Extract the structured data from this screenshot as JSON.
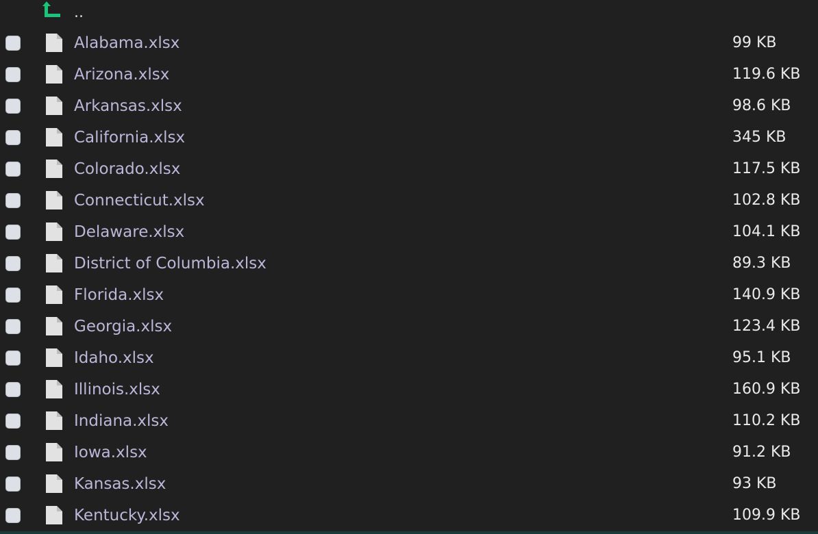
{
  "parent": {
    "label": "..",
    "icon": "up-arrow-icon",
    "icon_color": "#1bc47a"
  },
  "files": [
    {
      "name": "Alabama.xlsx",
      "size": "99 KB"
    },
    {
      "name": "Arizona.xlsx",
      "size": "119.6 KB"
    },
    {
      "name": "Arkansas.xlsx",
      "size": "98.6 KB"
    },
    {
      "name": "California.xlsx",
      "size": "345 KB"
    },
    {
      "name": "Colorado.xlsx",
      "size": "117.5 KB"
    },
    {
      "name": "Connecticut.xlsx",
      "size": "102.8 KB"
    },
    {
      "name": "Delaware.xlsx",
      "size": "104.1 KB"
    },
    {
      "name": "District of Columbia.xlsx",
      "size": "89.3 KB"
    },
    {
      "name": "Florida.xlsx",
      "size": "140.9 KB"
    },
    {
      "name": "Georgia.xlsx",
      "size": "123.4 KB"
    },
    {
      "name": "Idaho.xlsx",
      "size": "95.1 KB"
    },
    {
      "name": "Illinois.xlsx",
      "size": "160.9 KB"
    },
    {
      "name": "Indiana.xlsx",
      "size": "110.2 KB"
    },
    {
      "name": "Iowa.xlsx",
      "size": "91.2 KB"
    },
    {
      "name": "Kansas.xlsx",
      "size": "93 KB"
    },
    {
      "name": "Kentucky.xlsx",
      "size": "109.9 KB"
    }
  ],
  "colors": {
    "background": "#202020",
    "file_name": "#bcb6d8",
    "file_size": "#eaeaea",
    "checkbox": "#dde0e6"
  }
}
